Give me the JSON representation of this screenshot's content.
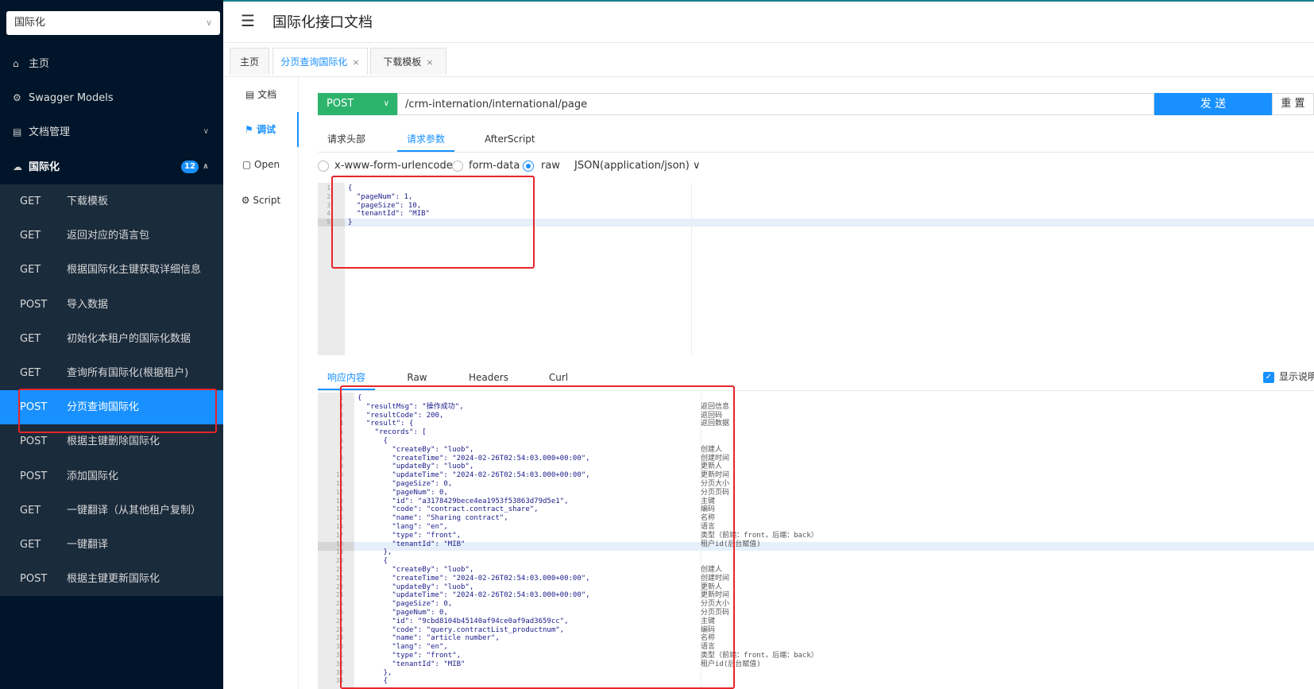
{
  "sidebar": {
    "group_select": "国际化",
    "nav": [
      {
        "icon": "home-icon",
        "label": "主页"
      },
      {
        "icon": "swagger-models-icon",
        "label": "Swagger Models"
      },
      {
        "icon": "document-manage-icon",
        "label": "文档管理"
      },
      {
        "icon": "cloud-icon",
        "label": "国际化",
        "badge": "12"
      }
    ],
    "apis": [
      {
        "method": "GET",
        "name": "下载模板"
      },
      {
        "method": "GET",
        "name": "返回对应的语言包"
      },
      {
        "method": "GET",
        "name": "根据国际化主键获取详细信息"
      },
      {
        "method": "POST",
        "name": "导入数据"
      },
      {
        "method": "GET",
        "name": "初始化本租户的国际化数据"
      },
      {
        "method": "GET",
        "name": "查询所有国际化(根据租户)"
      },
      {
        "method": "POST",
        "name": "分页查询国际化",
        "active": true
      },
      {
        "method": "POST",
        "name": "根据主键删除国际化"
      },
      {
        "method": "POST",
        "name": "添加国际化"
      },
      {
        "method": "GET",
        "name": "一键翻译（从其他租户复制）"
      },
      {
        "method": "GET",
        "name": "一键翻译"
      },
      {
        "method": "POST",
        "name": "根据主键更新国际化"
      }
    ]
  },
  "header": {
    "title": "国际化接口文档",
    "menu_icon": "menu-fold-icon"
  },
  "tabs": [
    {
      "label": "主页",
      "closable": false
    },
    {
      "label": "分页查询国际化",
      "closable": true,
      "active": true
    },
    {
      "label": "下载模板",
      "closable": true
    }
  ],
  "close_glyph": "×",
  "subnav": [
    {
      "icon": "doc-icon",
      "label": "文档"
    },
    {
      "icon": "debug-icon",
      "label": "调试",
      "active": true
    },
    {
      "icon": "open-icon",
      "label": "Open"
    },
    {
      "icon": "script-icon",
      "label": "Script"
    }
  ],
  "request": {
    "method": "POST",
    "url": "/crm-internation/international/page",
    "send_label": "发 送",
    "reset_label": "重 置",
    "tabs": [
      "请求头部",
      "请求参数",
      "AfterScript"
    ],
    "active_tab": "请求参数",
    "body_types": [
      "x-www-form-urlencoded",
      "form-data",
      "raw"
    ],
    "selected_body_type": "raw",
    "content_type": "JSON(application/json)",
    "code_lines": [
      "{",
      "  \"pageNum\": 1,",
      "  \"pageSize\": 10,",
      "  \"tenantId\": \"MIB\"",
      "}"
    ]
  },
  "response": {
    "tabs": [
      "响应内容",
      "Raw",
      "Headers",
      "Curl"
    ],
    "active_tab": "响应内容",
    "show_desc_label": "显示说明",
    "code_lines": [
      "{",
      "  \"resultMsg\": \"操作成功\",",
      "  \"resultCode\": 200,",
      "  \"result\": {",
      "    \"records\": [",
      "      {",
      "        \"createBy\": \"luob\",",
      "        \"createTime\": \"2024-02-26T02:54:03.000+00:00\",",
      "        \"updateBy\": \"luob\",",
      "        \"updateTime\": \"2024-02-26T02:54:03.000+00:00\",",
      "        \"pageSize\": 0,",
      "        \"pageNum\": 0,",
      "        \"id\": \"a3178429bece4ea1953f53863d79d5e1\",",
      "        \"code\": \"contract.contract_share\",",
      "        \"name\": \"Sharing contract\",",
      "        \"lang\": \"en\",",
      "        \"type\": \"front\",",
      "        \"tenantId\": \"MIB\"",
      "      },",
      "      {",
      "        \"createBy\": \"luob\",",
      "        \"createTime\": \"2024-02-26T02:54:03.000+00:00\",",
      "        \"updateBy\": \"luob\",",
      "        \"updateTime\": \"2024-02-26T02:54:03.000+00:00\",",
      "        \"pageSize\": 0,",
      "        \"pageNum\": 0,",
      "        \"id\": \"9cbd8104b45140af94ce0af9ad3659cc\",",
      "        \"code\": \"query.contractList_productnum\",",
      "        \"name\": \"article number\",",
      "        \"lang\": \"en\",",
      "        \"type\": \"front\",",
      "        \"tenantId\": \"MIB\"",
      "      },",
      "      {"
    ],
    "desc_lines": [
      "",
      "返回信息",
      "返回码",
      "返回数据",
      "",
      "",
      "创建人",
      "创建时间",
      "更新人",
      "更新时间",
      "分页大小",
      "分页页码",
      "主键",
      "编码",
      "名称",
      "语言",
      "类型（前端：front，后端：back）",
      "租户id(后台赋值)",
      "",
      "",
      "创建人",
      "创建时间",
      "更新人",
      "更新时间",
      "分页大小",
      "分页页码",
      "主键",
      "编码",
      "名称",
      "语言",
      "类型（前端：front，后端：back）",
      "租户id(后台赋值)",
      "",
      ""
    ]
  },
  "colors": {
    "sidebar_bg": "#001529",
    "accent": "#1890ff",
    "post_green": "#2db46c",
    "annotation_red": "#e8242a"
  }
}
